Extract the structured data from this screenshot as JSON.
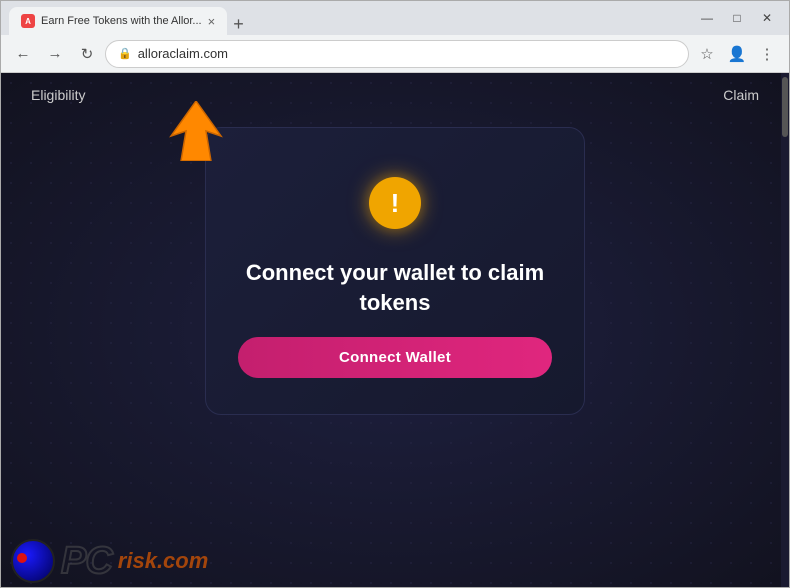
{
  "browser": {
    "tab": {
      "favicon_label": "A",
      "title": "Earn Free Tokens with the Allor...",
      "close_icon": "×"
    },
    "tab_new_icon": "+",
    "window_controls": {
      "minimize": "—",
      "maximize": "□",
      "close": "✕"
    },
    "address_bar": {
      "back_icon": "←",
      "forward_icon": "→",
      "reload_icon": "↻",
      "url": "alloraclaim.com",
      "lock_icon": "🔒",
      "star_icon": "☆",
      "profile_icon": "👤",
      "menu_icon": "⋮"
    }
  },
  "page": {
    "nav": {
      "left_text": "Eligibility",
      "right_text": "Claim"
    },
    "card": {
      "title": "Connect your wallet to claim tokens",
      "connect_button_label": "Connect Wallet",
      "warning_icon_symbol": "!"
    }
  },
  "watermark": {
    "logo_text": "PC",
    "suffix_text": "risk.com"
  }
}
